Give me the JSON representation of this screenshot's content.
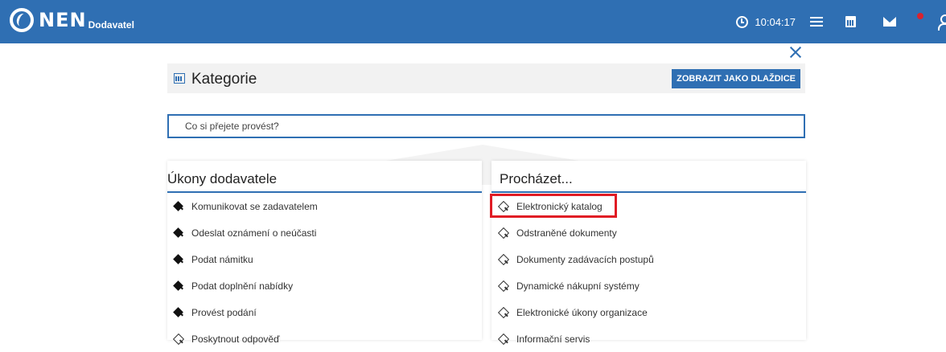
{
  "header": {
    "logo_text": "NEN",
    "logo_sub": "Dodavatel",
    "time": "10:04:17",
    "icons": [
      "clock-icon",
      "menu-icon",
      "calculator-icon",
      "mail-icon",
      "user-icon"
    ],
    "brand_color": "#2f6fb3",
    "notification_color": "#d9232e"
  },
  "page": {
    "title": "Kategorie",
    "tile_button_label": "ZOBRAZIT JAKO DLAŽDICE",
    "search_placeholder": "Co si přejete provést?"
  },
  "left_panel": {
    "title": "Úkony dodavatele",
    "items": [
      {
        "label": "Komunikovat se zadavatelem",
        "icon": "filled"
      },
      {
        "label": "Odeslat oznámení o neúčasti",
        "icon": "filled"
      },
      {
        "label": "Podat námitku",
        "icon": "filled"
      },
      {
        "label": "Podat doplnění nabídky",
        "icon": "filled"
      },
      {
        "label": "Provést podání",
        "icon": "filled"
      },
      {
        "label": "Poskytnout odpověď",
        "icon": "outline"
      }
    ]
  },
  "right_panel": {
    "title": "Procházet...",
    "items": [
      {
        "label": "Elektronický katalog",
        "icon": "outline",
        "highlighted": true
      },
      {
        "label": "Odstraněné dokumenty",
        "icon": "outline"
      },
      {
        "label": "Dokumenty zadávacích postupů",
        "icon": "outline"
      },
      {
        "label": "Dynamické nákupní systémy",
        "icon": "outline"
      },
      {
        "label": "Elektronické úkony organizace",
        "icon": "outline"
      },
      {
        "label": "Informační servis",
        "icon": "outline"
      }
    ]
  }
}
